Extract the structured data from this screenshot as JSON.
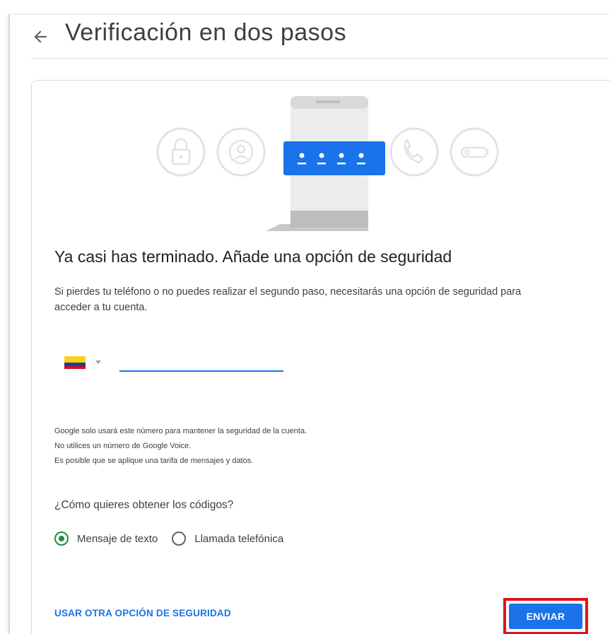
{
  "header": {
    "title": "Verificación en dos pasos",
    "back_icon": "arrow-back-icon"
  },
  "illustration": {
    "icons": [
      "lock-icon",
      "account-circle-icon",
      "password-dots-icon",
      "phone-icon",
      "key-icon"
    ],
    "accent": "#1a73e8"
  },
  "card": {
    "title": "Ya casi has terminado. Añade una opción de seguridad",
    "description": "Si pierdes tu teléfono o no puedes realizar el segundo paso, necesitarás una opción de seguridad para acceder a tu cuenta."
  },
  "phone": {
    "country_flag": "colombia-flag-icon",
    "value": "",
    "placeholder": ""
  },
  "notes": [
    "Google solo usará este número para mantener la seguridad de la cuenta.",
    "No utilices un número de Google Voice.",
    "Es posible que se aplique una tarifa de mensajes y datos."
  ],
  "codes": {
    "question": "¿Cómo quieres obtener los códigos?",
    "options": [
      {
        "label": "Mensaje de texto",
        "checked": true
      },
      {
        "label": "Llamada telefónica",
        "checked": false
      }
    ]
  },
  "actions": {
    "alt_option_label": "USAR OTRA OPCIÓN DE SEGURIDAD",
    "send_label": "ENVIAR"
  },
  "colors": {
    "primary": "#1a73e8",
    "radio_selected": "#1e8e3e",
    "highlight": "#e0141e"
  }
}
